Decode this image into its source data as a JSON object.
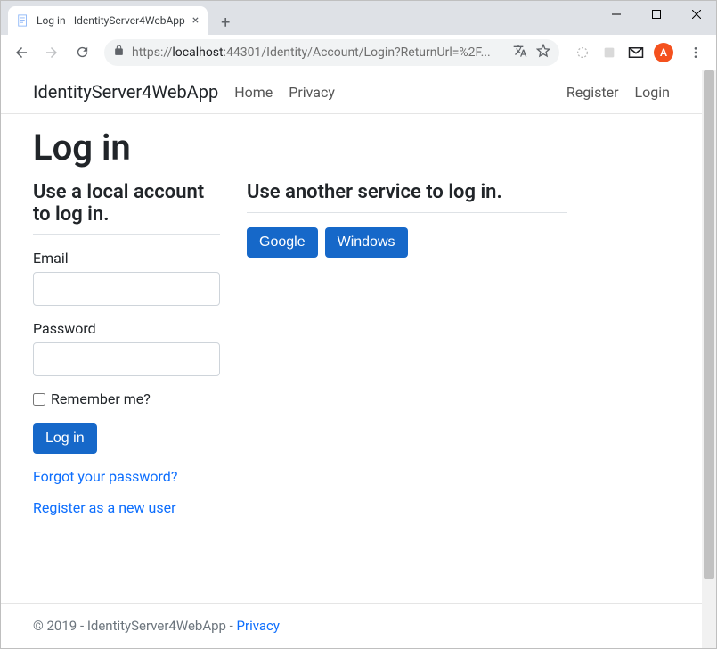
{
  "browser": {
    "tab_title": "Log in - IdentityServer4WebApp",
    "url_prefix": "https://",
    "url_host": "localhost",
    "url_rest": ":44301/Identity/Account/Login?ReturnUrl=%2F...",
    "avatar_initial": "A"
  },
  "navbar": {
    "brand": "IdentityServer4WebApp",
    "links_left": [
      "Home",
      "Privacy"
    ],
    "links_right": [
      "Register",
      "Login"
    ]
  },
  "page": {
    "title": "Log in",
    "local": {
      "heading": "Use a local account to log in.",
      "email_label": "Email",
      "email_value": "",
      "password_label": "Password",
      "password_value": "",
      "remember_label": "Remember me?",
      "remember_checked": false,
      "submit_label": "Log in",
      "forgot_link": "Forgot your password?",
      "register_link": "Register as a new user"
    },
    "external": {
      "heading": "Use another service to log in.",
      "providers": [
        "Google",
        "Windows"
      ]
    }
  },
  "footer": {
    "text": "© 2019 - IdentityServer4WebApp - ",
    "privacy_label": "Privacy"
  }
}
